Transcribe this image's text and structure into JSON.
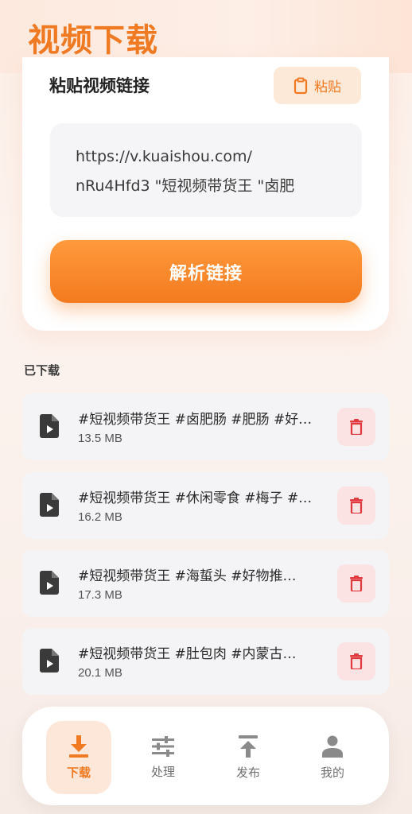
{
  "header": {
    "title": "视频下载"
  },
  "input_card": {
    "title": "粘贴视频链接",
    "paste_label": "粘贴",
    "link_line1": "https://v.kuaishou.com/",
    "link_line2": "nRu4Hfd3 \"短视频带货王 \"卤肥",
    "parse_label": "解析链接"
  },
  "downloads": {
    "section_label": "已下载",
    "items": [
      {
        "title": "#短视频带货王 #卤肥肠 #肥肠 #好…",
        "size": "13.5 MB"
      },
      {
        "title": "#短视频带货王 #休闲零食 #梅子 #…",
        "size": "16.2 MB"
      },
      {
        "title": "#短视频带货王 #海蜇头 #好物推…",
        "size": "17.3 MB"
      },
      {
        "title": "#短视频带货王 #肚包肉 #内蒙古…",
        "size": "20.1 MB"
      }
    ]
  },
  "nav": {
    "items": [
      {
        "label": "下载",
        "icon": "download-icon",
        "active": true
      },
      {
        "label": "处理",
        "icon": "sliders-icon",
        "active": false
      },
      {
        "label": "发布",
        "icon": "upload-icon",
        "active": false
      },
      {
        "label": "我的",
        "icon": "person-icon",
        "active": false
      }
    ]
  },
  "colors": {
    "accent": "#f07a22",
    "delete": "#e0393e",
    "icon_dark": "#3a3a3a"
  }
}
